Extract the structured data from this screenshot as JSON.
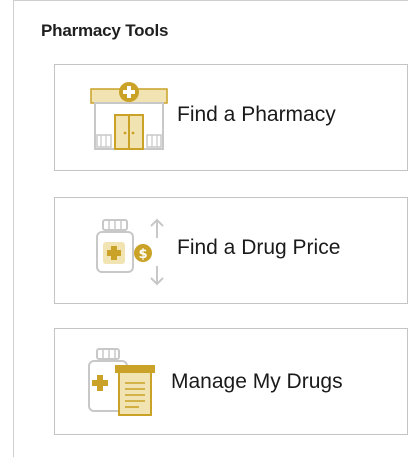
{
  "panel": {
    "title": "Pharmacy Tools"
  },
  "tools": [
    {
      "label": "Find a Pharmacy",
      "icon": "pharmacy-store-icon"
    },
    {
      "label": "Find a Drug Price",
      "icon": "drug-price-icon"
    },
    {
      "label": "Manage My Drugs",
      "icon": "manage-drugs-icon"
    }
  ],
  "colors": {
    "accent_gold": "#c9a227",
    "accent_gold_light": "#f2e3b3",
    "icon_gray": "#c8c8c8",
    "border": "#c4c4c4",
    "text": "#1a1a1a"
  }
}
